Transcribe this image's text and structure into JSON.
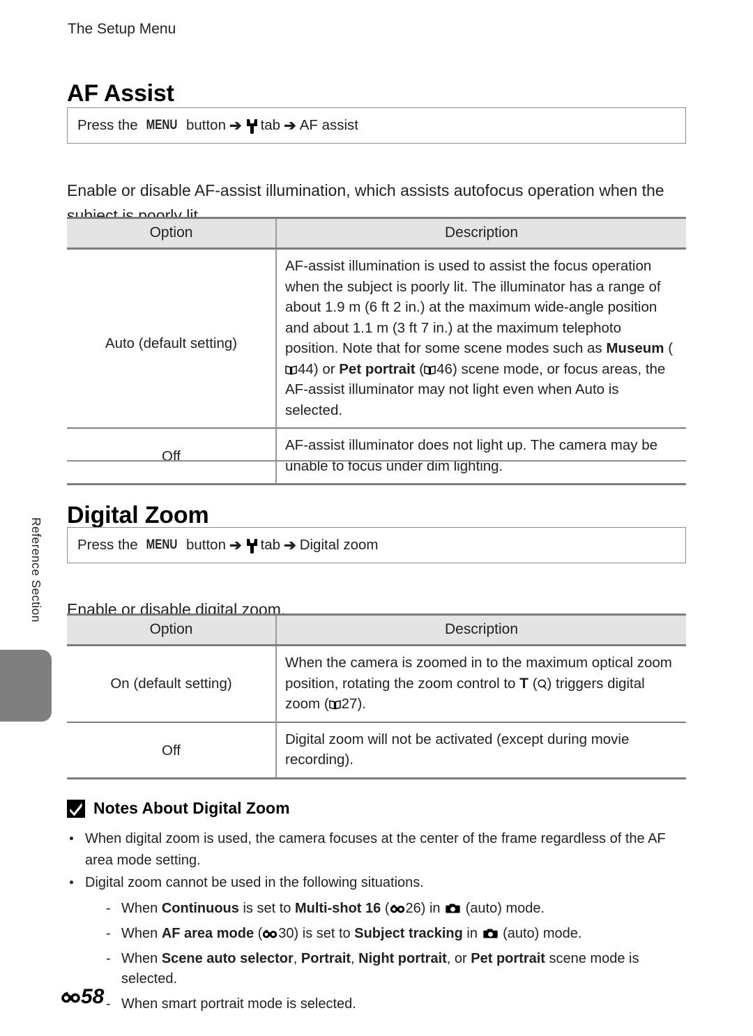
{
  "running_head": "The Setup Menu",
  "side_tab": {
    "label": "Reference Section"
  },
  "sections": [
    {
      "heading": "AF Assist",
      "navbox": {
        "prefix": "Press the",
        "menu_label": "MENU",
        "button_word": "button",
        "tab_icon": "wrench-icon",
        "tab_word": "tab",
        "target": "AF assist",
        "arrow": "➔"
      },
      "intro": "Enable or disable AF-assist illumination, which assists autofocus operation when the subject is poorly lit.",
      "table": {
        "headers": [
          "Option",
          "Description"
        ],
        "rows": [
          {
            "option": "Auto (default setting)",
            "description_parts": [
              {
                "t": "text",
                "v": "AF-assist illumination is used to assist the focus operation when the subject is poorly lit. The illuminator has a range of about 1.9 m (6 ft 2 in.) at the maximum wide-angle position and about 1.1 m (3 ft 7 in.) at the maximum telephoto position. Note that for some scene modes such as "
              },
              {
                "t": "bold",
                "v": "Museum"
              },
              {
                "t": "text",
                "v": " ("
              },
              {
                "t": "book-icon",
                "v": "book-icon"
              },
              {
                "t": "text",
                "v": "44) or "
              },
              {
                "t": "bold",
                "v": "Pet portrait"
              },
              {
                "t": "text",
                "v": " ("
              },
              {
                "t": "book-icon",
                "v": "book-icon"
              },
              {
                "t": "text",
                "v": "46) scene mode, or focus areas, the AF-assist illuminator may not light even when Auto is selected."
              }
            ]
          },
          {
            "option": "Off",
            "description_parts": [
              {
                "t": "text",
                "v": "AF-assist illuminator does not light up. The camera may be unable to focus under dim lighting."
              }
            ]
          }
        ]
      }
    },
    {
      "heading": "Digital Zoom",
      "navbox": {
        "prefix": "Press the",
        "menu_label": "MENU",
        "button_word": "button",
        "tab_icon": "wrench-icon",
        "tab_word": "tab",
        "target": "Digital zoom",
        "arrow": "➔"
      },
      "intro": "Enable or disable digital zoom.",
      "table": {
        "headers": [
          "Option",
          "Description"
        ],
        "rows": [
          {
            "option": "On (default setting)",
            "description_parts": [
              {
                "t": "text",
                "v": "When the camera is zoomed in to the maximum optical zoom position, rotating the zoom control to "
              },
              {
                "t": "tele-T",
                "v": "T"
              },
              {
                "t": "text",
                "v": " ("
              },
              {
                "t": "mag-icon",
                "v": "magnifier-icon"
              },
              {
                "t": "text",
                "v": ") triggers digital zoom ("
              },
              {
                "t": "book-icon",
                "v": "book-icon"
              },
              {
                "t": "text",
                "v": "27)."
              }
            ]
          },
          {
            "option": "Off",
            "description_parts": [
              {
                "t": "text",
                "v": "Digital zoom will not be activated (except during movie recording)."
              }
            ]
          }
        ]
      }
    }
  ],
  "notes": {
    "icon": "check-square-icon",
    "heading": "Notes About Digital Zoom",
    "bullets": [
      {
        "parts": [
          {
            "t": "text",
            "v": "When digital zoom is used, the camera focuses at the center of the frame regardless of the AF area mode setting."
          }
        ]
      },
      {
        "parts": [
          {
            "t": "text",
            "v": "Digital zoom cannot be used in the following situations."
          }
        ],
        "sub": [
          {
            "dash": "-",
            "parts": [
              {
                "t": "text",
                "v": "When "
              },
              {
                "t": "bold",
                "v": "Continuous"
              },
              {
                "t": "text",
                "v": " is set to "
              },
              {
                "t": "bold",
                "v": "Multi-shot 16"
              },
              {
                "t": "text",
                "v": " ("
              },
              {
                "t": "ref-icon",
                "v": "reference-section-icon"
              },
              {
                "t": "text",
                "v": "26) in "
              },
              {
                "t": "cam-icon",
                "v": "camera-icon"
              },
              {
                "t": "text",
                "v": " (auto) mode."
              }
            ]
          },
          {
            "dash": "-",
            "parts": [
              {
                "t": "text",
                "v": "When "
              },
              {
                "t": "bold",
                "v": "AF area mode"
              },
              {
                "t": "text",
                "v": " ("
              },
              {
                "t": "ref-icon",
                "v": "reference-section-icon"
              },
              {
                "t": "text",
                "v": "30) is set to "
              },
              {
                "t": "bold",
                "v": "Subject tracking"
              },
              {
                "t": "text",
                "v": " in "
              },
              {
                "t": "cam-icon",
                "v": "camera-icon"
              },
              {
                "t": "text",
                "v": " (auto) mode."
              }
            ]
          },
          {
            "dash": "-",
            "parts": [
              {
                "t": "text",
                "v": "When "
              },
              {
                "t": "bold",
                "v": "Scene auto selector"
              },
              {
                "t": "text",
                "v": ", "
              },
              {
                "t": "bold",
                "v": "Portrait"
              },
              {
                "t": "text",
                "v": ", "
              },
              {
                "t": "bold",
                "v": "Night portrait"
              },
              {
                "t": "text",
                "v": ", or "
              },
              {
                "t": "bold",
                "v": "Pet portrait"
              },
              {
                "t": "text",
                "v": " scene mode is selected."
              }
            ]
          },
          {
            "dash": "-",
            "parts": [
              {
                "t": "text",
                "v": "When smart portrait mode is selected."
              }
            ]
          }
        ]
      }
    ]
  },
  "footer": {
    "icon": "reference-section-icon",
    "page_number": "58"
  }
}
